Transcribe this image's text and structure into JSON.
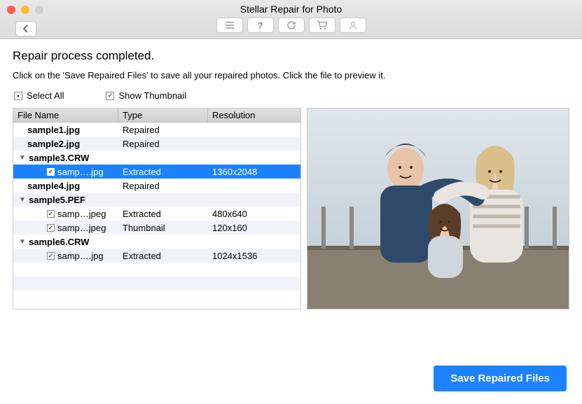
{
  "window": {
    "title": "Stellar Repair for Photo"
  },
  "headline": "Repair process completed.",
  "subline": "Click on the 'Save Repaired Files' to save all your repaired photos. Click the file to preview it.",
  "options": {
    "select_all": "Select All",
    "show_thumb": "Show Thumbnail"
  },
  "table": {
    "headers": {
      "name": "File Name",
      "type": "Type",
      "resolution": "Resolution"
    },
    "rows": [
      {
        "kind": "file",
        "name": "sample1.jpg",
        "type": "Repaired",
        "res": ""
      },
      {
        "kind": "file",
        "name": "sample2.jpg",
        "type": "Repaired",
        "res": ""
      },
      {
        "kind": "group",
        "name": "sample3.CRW",
        "type": "",
        "res": ""
      },
      {
        "kind": "child",
        "name": "samp….jpg",
        "type": "Extracted",
        "res": "1360x2048",
        "selected": true
      },
      {
        "kind": "file",
        "name": "sample4.jpg",
        "type": "Repaired",
        "res": ""
      },
      {
        "kind": "group",
        "name": "sample5.PEF",
        "type": "",
        "res": ""
      },
      {
        "kind": "child",
        "name": "samp…jpeg",
        "type": "Extracted",
        "res": "480x640"
      },
      {
        "kind": "child",
        "name": "samp…jpeg",
        "type": "Thumbnail",
        "res": "120x160"
      },
      {
        "kind": "group",
        "name": "sample6.CRW",
        "type": "",
        "res": ""
      },
      {
        "kind": "child",
        "name": "samp….jpg",
        "type": "Extracted",
        "res": "1024x1536"
      }
    ]
  },
  "save_button": "Save Repaired Files",
  "icons": {
    "list": "list-icon",
    "help": "help-icon",
    "refresh": "refresh-icon",
    "cart": "cart-icon",
    "user": "user-icon"
  }
}
